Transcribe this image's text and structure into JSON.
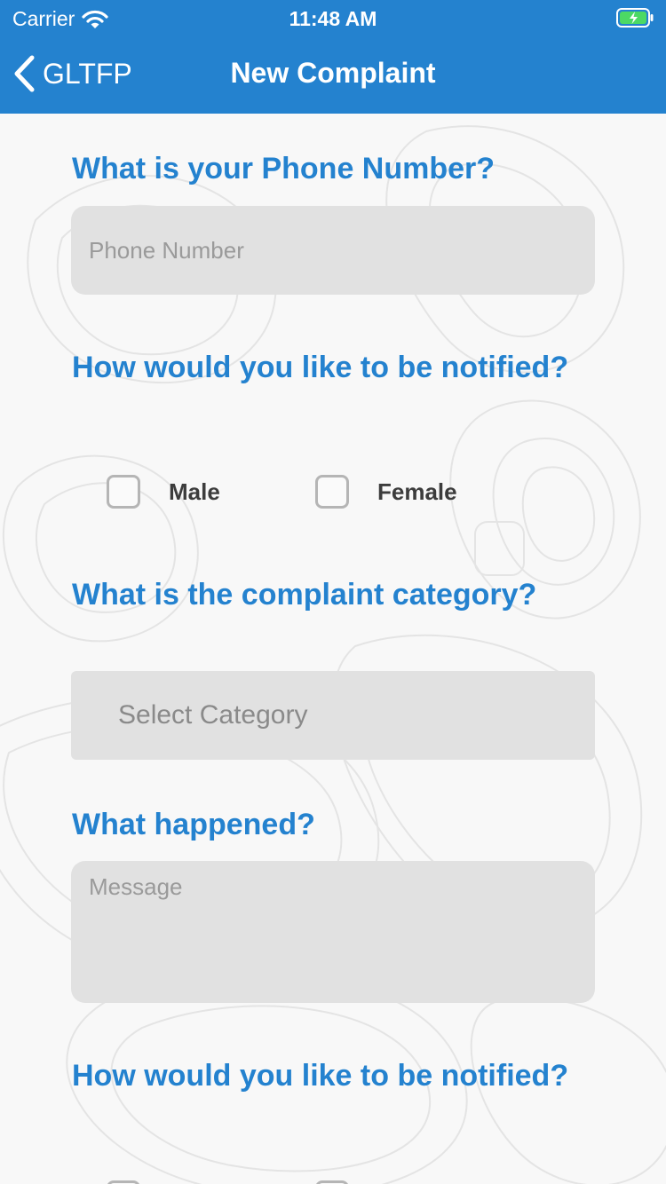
{
  "status_bar": {
    "carrier": "Carrier",
    "time": "11:48 AM",
    "wifi_icon": "wifi-icon",
    "battery_icon": "battery-charging-icon"
  },
  "nav": {
    "back_label": "GLTFP",
    "title": "New Complaint",
    "back_icon": "chevron-left-icon"
  },
  "form": {
    "phone": {
      "question": "What is your Phone Number?",
      "placeholder": "Phone Number",
      "value": ""
    },
    "notify_1": {
      "question": "How would you like to be notified?",
      "options": [
        "Male",
        "Female"
      ]
    },
    "category": {
      "question": "What is the complaint category?",
      "selected": "Select Category"
    },
    "message": {
      "question": "What happened?",
      "placeholder": "Message",
      "value": ""
    },
    "notify_2": {
      "question": "How would you like to be notified?"
    }
  },
  "colors": {
    "accent": "#2482cf",
    "background": "#f8f8f8",
    "field": "#e1e1e1"
  }
}
